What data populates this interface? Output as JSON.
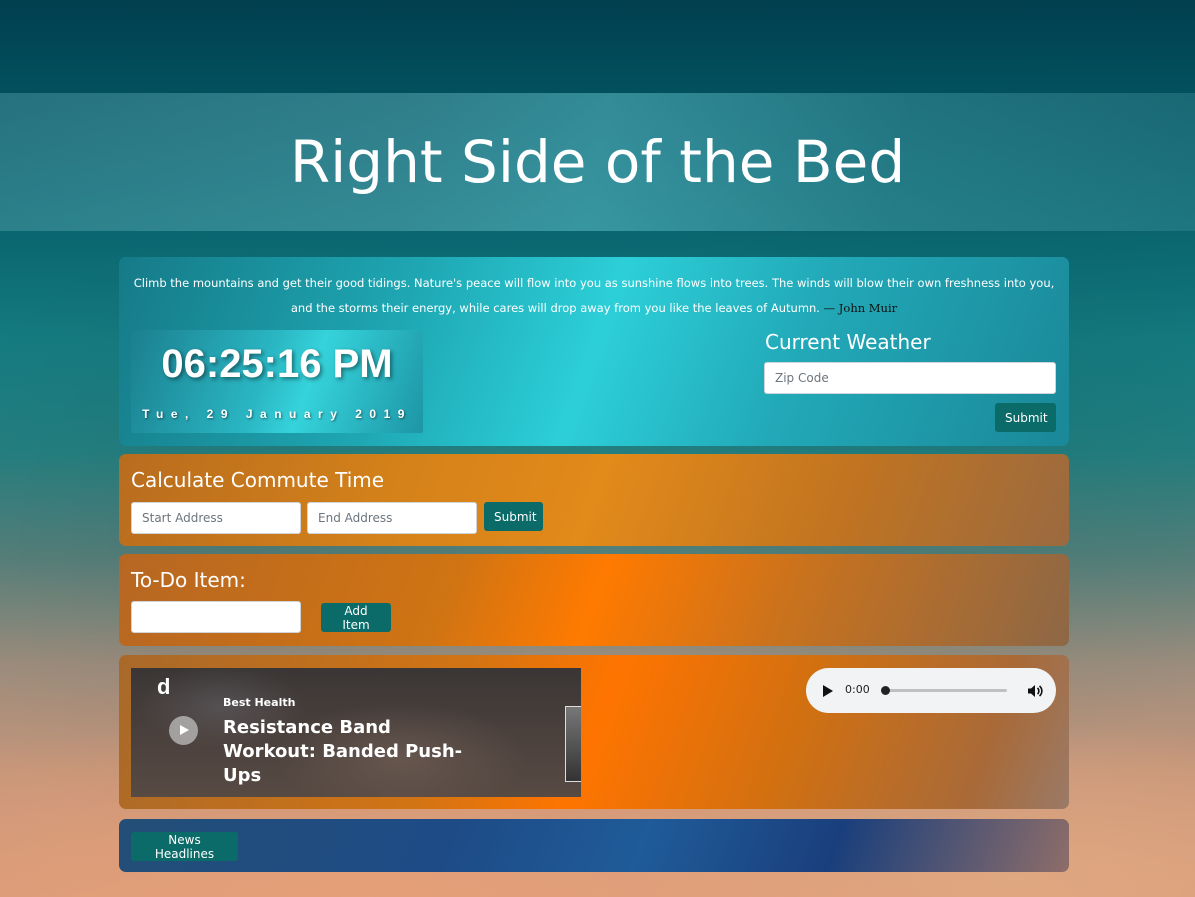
{
  "header": {
    "title": "Right Side of the Bed"
  },
  "quote": {
    "text": "Climb the mountains and get their good tidings. Nature's peace will flow into you as sunshine flows into trees. The winds will blow their own freshness into you, and the storms their energy, while cares will drop away from you like the leaves of Autumn. ",
    "author": "— John Muir"
  },
  "clock": {
    "time": "06:25:16 PM",
    "date": "Tue, 29 January 2019"
  },
  "weather": {
    "title": "Current Weather",
    "zip_placeholder": "Zip Code",
    "submit_label": "Submit"
  },
  "commute": {
    "title": "Calculate Commute Time",
    "start_placeholder": "Start Address",
    "end_placeholder": "End Address",
    "submit_label": "Submit"
  },
  "todo": {
    "title": "To-Do Item:",
    "input_value": "",
    "add_label": "Add Item"
  },
  "video": {
    "logo": "d",
    "brand": "Best Health",
    "title": "Resistance Band Workout: Banded Push-Ups"
  },
  "audio": {
    "time": "0:00",
    "progress": 0
  },
  "news": {
    "button_label": "News Headlines"
  },
  "colors": {
    "button": "#0a6b68",
    "quote_panel": "#2ccfd8",
    "commute_panel": "#e28a1a",
    "todo_panel": "#ff7a00",
    "news_panel": "#1f5b99"
  }
}
